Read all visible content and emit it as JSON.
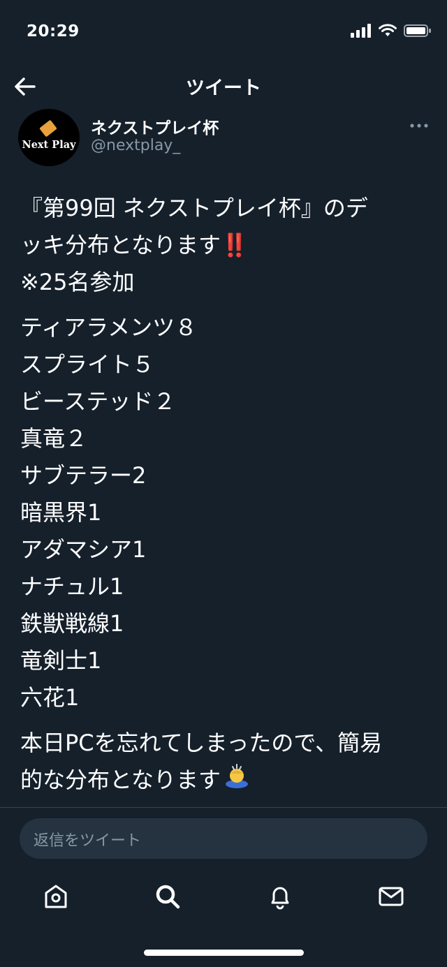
{
  "status_bar": {
    "time": "20:29"
  },
  "header": {
    "title": "ツイート",
    "back_icon": "arrow-left-icon"
  },
  "author": {
    "name": "ネクストプレイ杯",
    "handle": "@nextplay_",
    "avatar_text": "Next Play"
  },
  "tweet": {
    "intro_lines": [
      "『第99回 ネクストプレイ杯』のデ",
      "ッキ分布となります‼️",
      "※25名参加"
    ],
    "decks": [
      "ティアラメンツ８",
      "スプライト５",
      "ビーステッド２",
      "真竜２",
      "サブテラー2",
      "暗黒界1",
      "アダマシア1",
      "ナチュル1",
      "鉄獣戦線1",
      "竜剣士1",
      "六花1"
    ],
    "outro_line1": "本日PCを忘れてしまったので、簡易",
    "outro_line2": "的な分布となります"
  },
  "reply": {
    "placeholder": "返信をツイート"
  },
  "nav": [
    "home-icon",
    "search-icon",
    "notifications-icon",
    "messages-icon"
  ],
  "colors": {
    "background": "#15202b",
    "secondary_text": "#8899a6",
    "input_bg": "#253341"
  }
}
